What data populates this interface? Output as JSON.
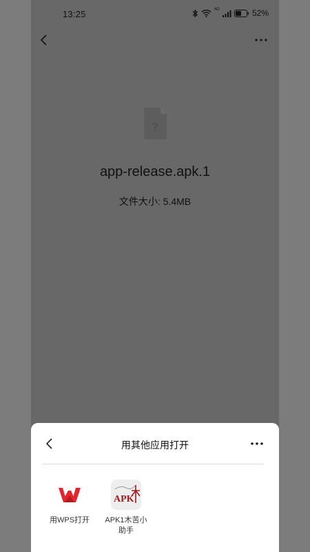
{
  "status_bar": {
    "time": "13:25",
    "network": "4G",
    "battery": "52%"
  },
  "file": {
    "name": "app-release.apk.1",
    "size_text": "文件大小: 5.4MB",
    "icon_glyph": "?"
  },
  "sheet": {
    "title": "用其他应用打开",
    "apps": [
      {
        "label": "用WPS打开"
      },
      {
        "label_line1": "APK1木苦小",
        "label_line2": "助手",
        "icon_text": "APK"
      }
    ]
  },
  "colors": {
    "overlay": "#686868",
    "outer": "#7b7b7b",
    "wps_red": "#e3262e",
    "apk_red": "#a31a1e"
  }
}
